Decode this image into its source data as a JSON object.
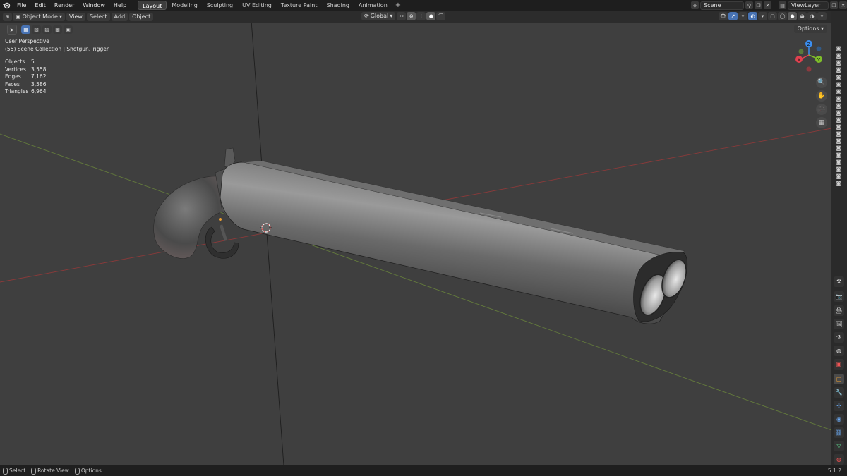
{
  "menubar": {
    "logo_icon": "blender-logo-icon",
    "items": [
      "File",
      "Edit",
      "Render",
      "Window",
      "Help"
    ],
    "workspaces": [
      "Layout",
      "Modeling",
      "Sculpting",
      "UV Editing",
      "Texture Paint",
      "Shading",
      "Animation"
    ],
    "active_workspace": "Layout",
    "add_workspace": "+",
    "scene": "Scene",
    "view_layer": "ViewLayer"
  },
  "viewport_header": {
    "mode": "Object Mode",
    "menus": [
      "View",
      "Select",
      "Add",
      "Object"
    ],
    "transform_orientation": "Global",
    "options": "Options"
  },
  "overlay": {
    "perspective": "User Perspective",
    "collection": "(55) Scene Collection | Shotgun.Trigger",
    "stats": [
      {
        "label": "Objects",
        "value": "5"
      },
      {
        "label": "Vertices",
        "value": "3,558"
      },
      {
        "label": "Edges",
        "value": "7,162"
      },
      {
        "label": "Faces",
        "value": "3,586"
      },
      {
        "label": "Triangles",
        "value": "6,964"
      }
    ]
  },
  "gizmo": {
    "x": "X",
    "y": "Y",
    "z": "Z",
    "colors": {
      "x": "#e0414f",
      "y": "#7fbf2a",
      "z": "#3b8ff2"
    }
  },
  "statusbar": {
    "items": [
      "Select",
      "Rotate View",
      "Options"
    ],
    "version": "5.1.2"
  },
  "colors": {
    "viewport_bg": "#3f3f3f",
    "accent": "#4772b3",
    "x_axis": "#9c3b3b",
    "y_axis": "#6f8a3a"
  }
}
